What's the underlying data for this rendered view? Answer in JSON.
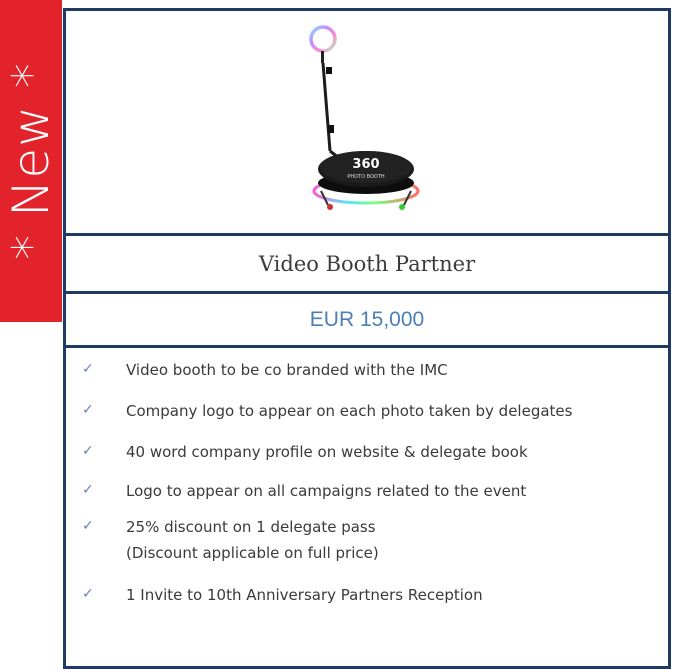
{
  "ribbon": {
    "label": "* New *"
  },
  "product": {
    "image_alt": "360 photo booth with ring light",
    "booth_brand": "360",
    "booth_subtitle": "PHOTO BOOTH",
    "title": "Video Booth Partner",
    "price": "EUR 15,000"
  },
  "features": [
    {
      "text": "Video booth to be co branded with the IMC"
    },
    {
      "text": "Company logo to appear on each photo taken by delegates"
    },
    {
      "text": "40 word company profile on website & delegate book"
    },
    {
      "text": "Logo to appear on all campaigns related to the event"
    },
    {
      "text": "25% discount on 1 delegate pass",
      "note": "(Discount applicable on full price)"
    },
    {
      "text": "1 Invite to 10th Anniversary Partners Reception"
    }
  ],
  "colors": {
    "ribbon": "#e2232b",
    "border": "#1f3b63",
    "price": "#4a7fb8",
    "check": "#6b7fb5"
  },
  "icons": {
    "check": "check-icon"
  }
}
